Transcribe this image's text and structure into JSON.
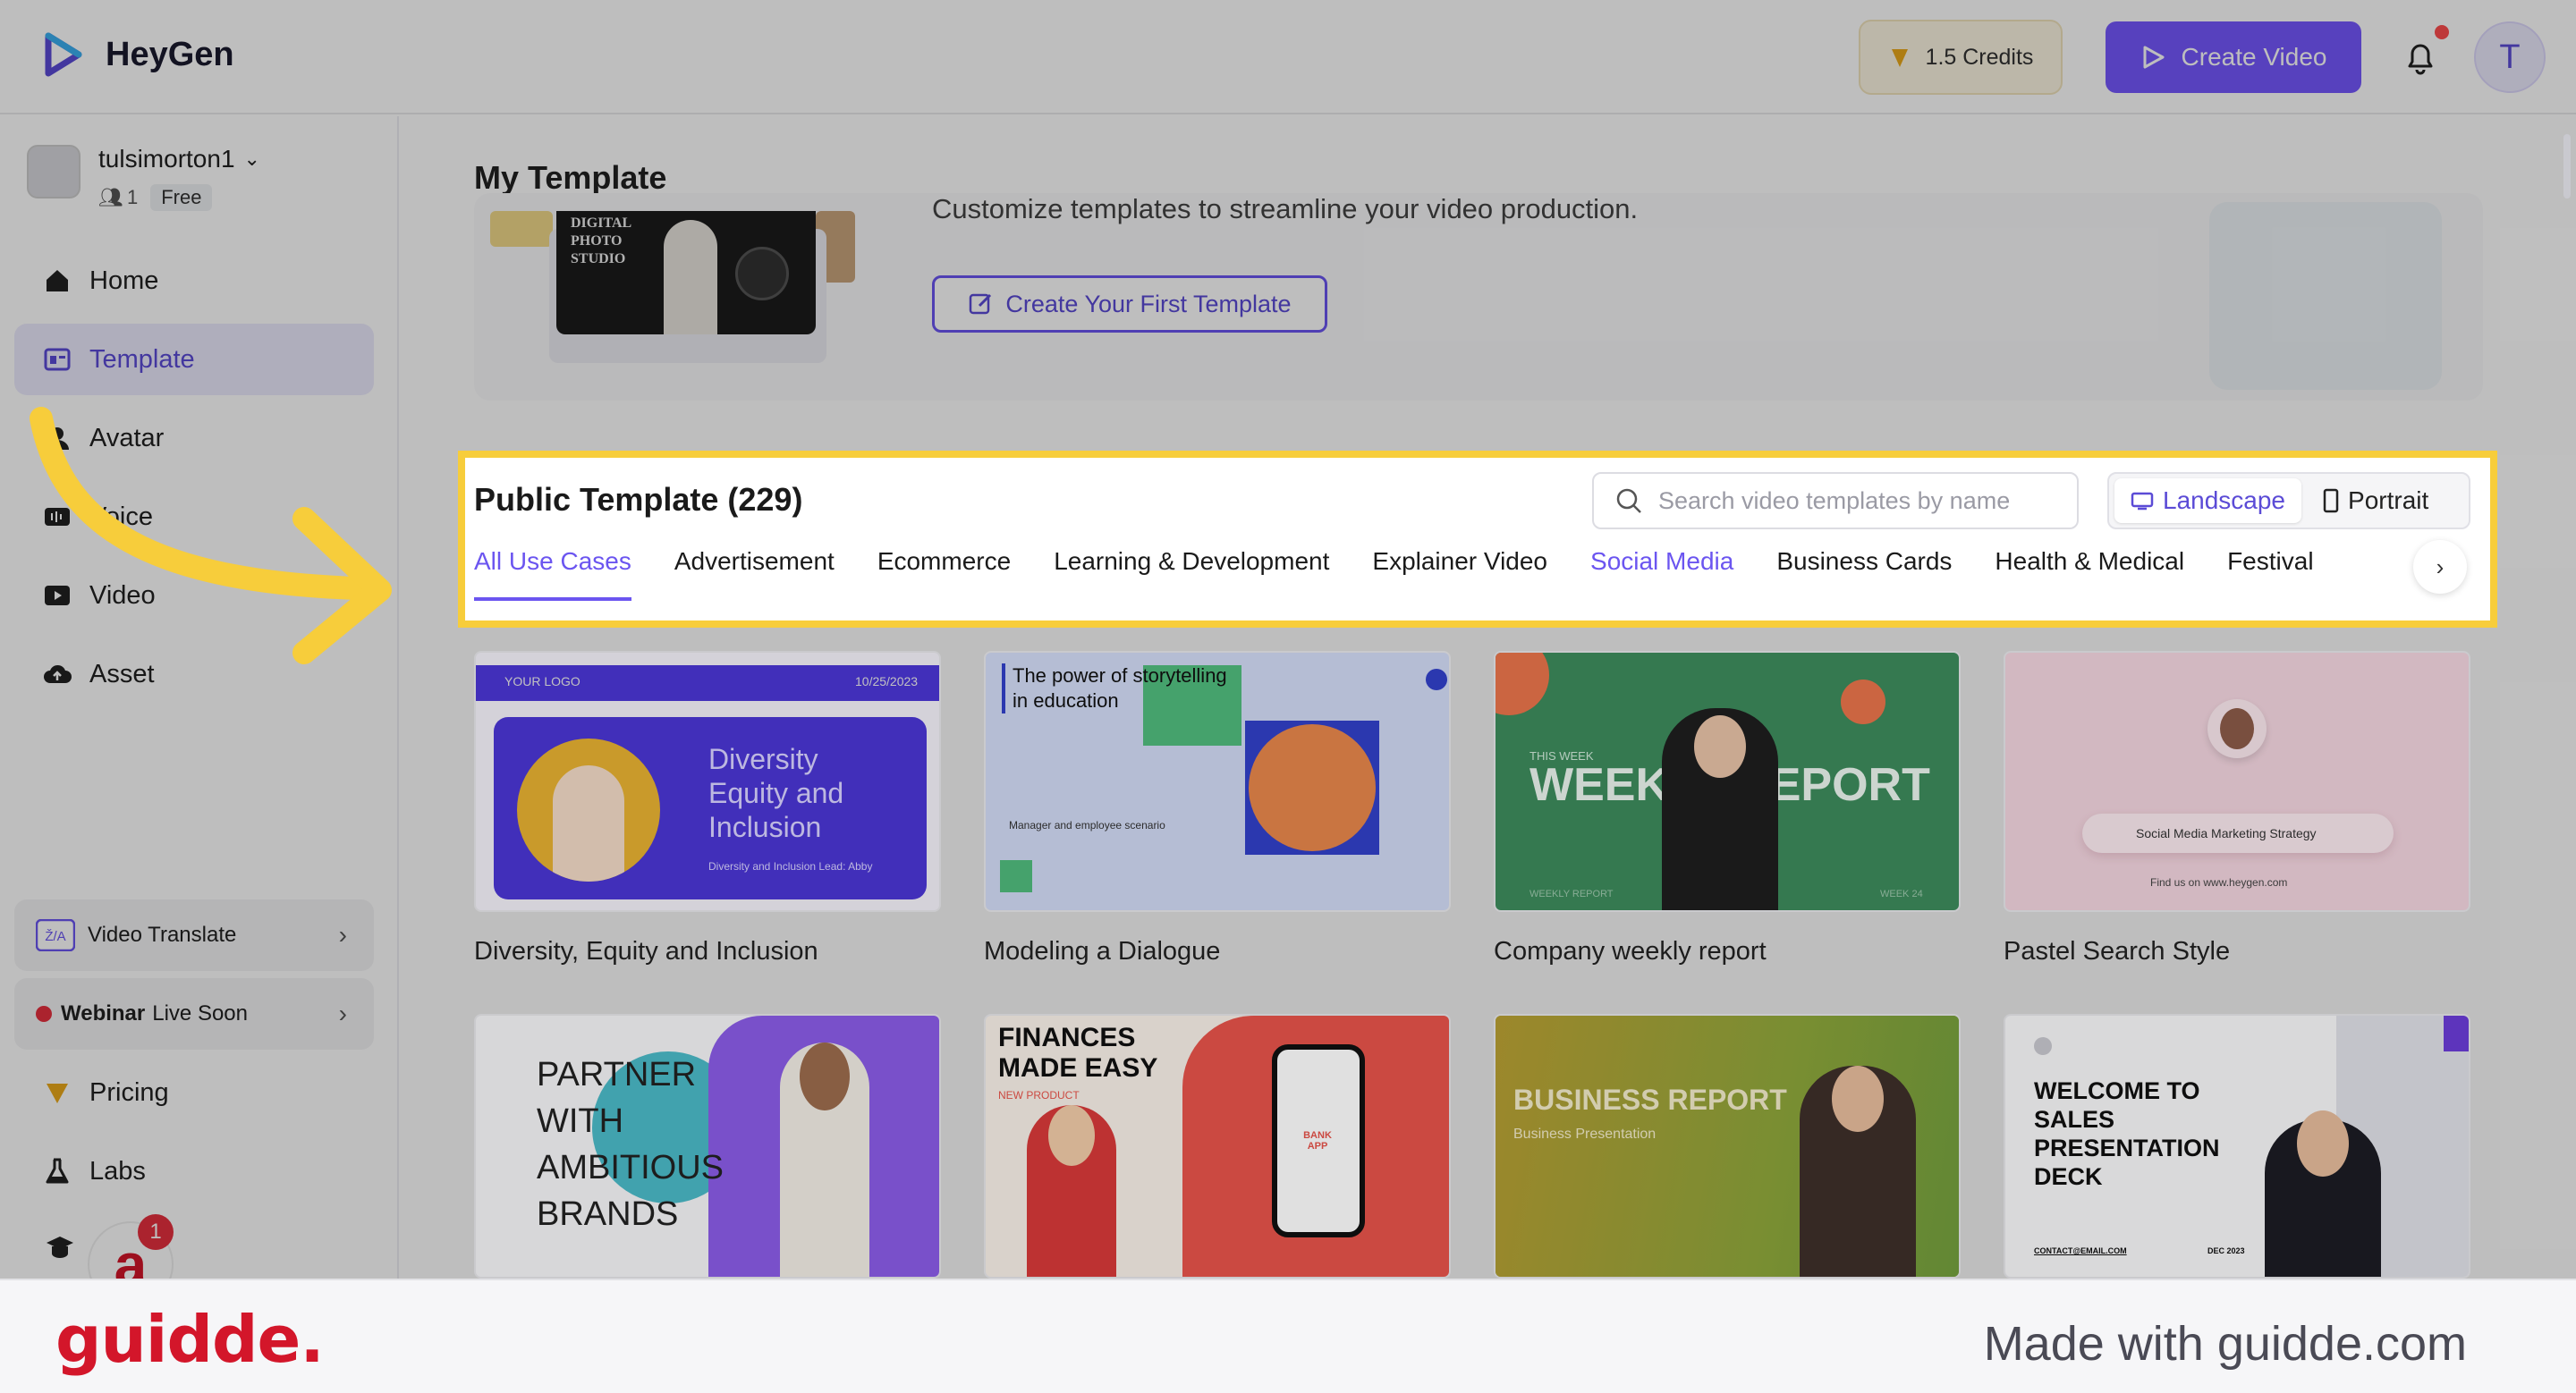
{
  "app": {
    "name": "HeyGen"
  },
  "header": {
    "credits_label": "1.5 Credits",
    "create_label": "Create Video",
    "avatar_initial": "T"
  },
  "account": {
    "name": "tulsimorton1",
    "members": "1",
    "plan": "Free"
  },
  "sidebar": {
    "items": [
      {
        "label": "Home",
        "icon": "home-icon"
      },
      {
        "label": "Template",
        "icon": "template-icon",
        "active": true
      },
      {
        "label": "Avatar",
        "icon": "avatar-icon"
      },
      {
        "label": "Voice",
        "icon": "voice-icon"
      },
      {
        "label": "Video",
        "icon": "video-icon"
      },
      {
        "label": "Asset",
        "icon": "asset-icon"
      }
    ],
    "promos": [
      {
        "label": "Video Translate",
        "icon": "translate-icon"
      },
      {
        "label_bold": "Webinar",
        "label": "Live Soon"
      }
    ],
    "bottom_items": [
      {
        "label": "Pricing",
        "icon": "pricing-icon"
      },
      {
        "label": "Labs",
        "icon": "labs-icon"
      }
    ],
    "notification_count": "1"
  },
  "my_template": {
    "title": "My Template",
    "subtitle": "Customize templates to streamline your video production.",
    "thumb_text": "DIGITAL PHOTO STUDIO",
    "create_first_label": "Create Your First Template"
  },
  "public_template": {
    "title": "Public Template (229)",
    "search_placeholder": "Search video templates by name",
    "orientation": {
      "landscape": "Landscape",
      "portrait": "Portrait"
    },
    "tabs": [
      "All Use Cases",
      "Advertisement",
      "Ecommerce",
      "Learning & Development",
      "Explainer Video",
      "Social Media",
      "Business Cards",
      "Health & Medical",
      "Festival"
    ],
    "active_tab": "All Use Cases",
    "cards": [
      {
        "title": "Diversity, Equity and Inclusion",
        "thumb": {
          "logo": "YOUR LOGO",
          "date": "10/25/2023",
          "heading": "Diversity Equity and Inclusion",
          "caption": "Diversity and Inclusion Lead: Abby"
        }
      },
      {
        "title": "Modeling a Dialogue",
        "thumb": {
          "heading": "The power of storytelling in education",
          "caption": "Manager and employee scenario"
        }
      },
      {
        "title": "Company weekly report",
        "thumb": {
          "kicker": "THIS WEEK",
          "heading": "WEEKLY REPORT",
          "footer_left": "WEEKLY REPORT",
          "footer_right": "WEEK 24"
        }
      },
      {
        "title": "Pastel Search Style",
        "thumb": {
          "search_text": "Social Media Marketing Strategy",
          "caption": "Find us on www.heygen.com"
        }
      }
    ],
    "cards_row2": [
      {
        "heading": "PARTNER WITH AMBITIOUS BRANDS"
      },
      {
        "heading": "FINANCES MADE EASY",
        "kicker": "NEW PRODUCT",
        "phone_text": "BANK APP"
      },
      {
        "heading": "BUSINESS REPORT",
        "caption": "Business Presentation"
      },
      {
        "heading": "WELCOME TO SALES PRESENTATION DECK",
        "footer_left": "CONTACT@EMAIL.COM",
        "footer_right": "DEC 2023"
      }
    ]
  },
  "footer": {
    "brand": "guidde.",
    "made_with": "Made with guidde.com"
  },
  "colors": {
    "accent": "#6b55f0",
    "highlight": "#f7cd3b",
    "brand_red": "#d3162a",
    "arrow": "#f7cd3b"
  }
}
